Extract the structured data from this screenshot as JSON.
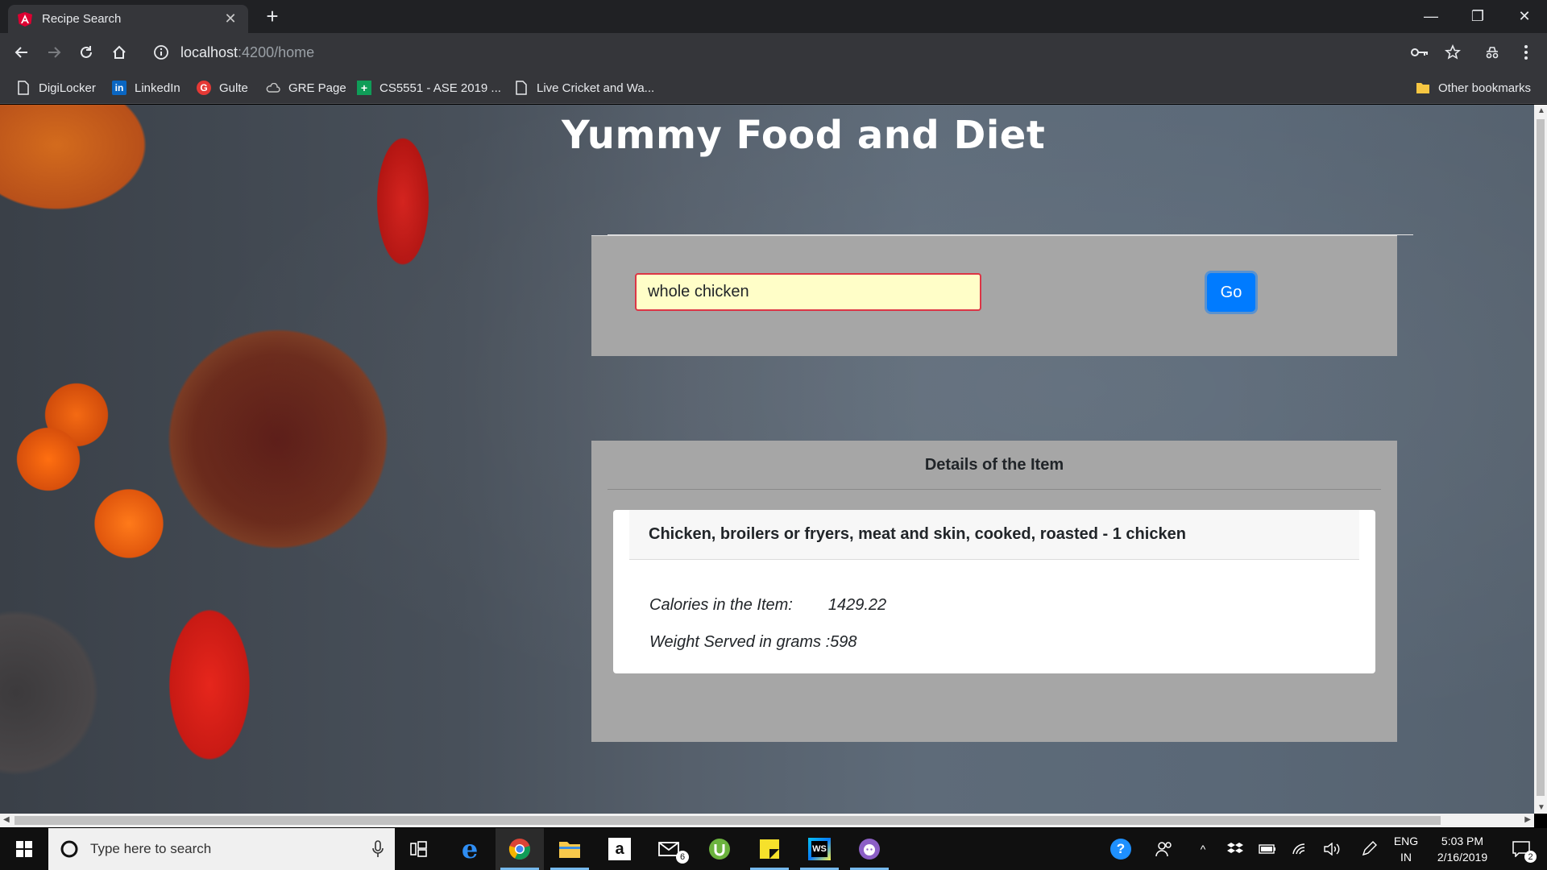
{
  "browser": {
    "tab_title": "Recipe Search",
    "url_host": "localhost",
    "url_path": ":4200/home",
    "bookmarks": [
      "DigiLocker",
      "LinkedIn",
      "Gulte",
      "GRE Page",
      "CS5551 - ASE 2019 ...",
      "Live Cricket and Wa..."
    ],
    "other_bookmarks": "Other bookmarks"
  },
  "page": {
    "title": "Yummy Food and Diet",
    "search": {
      "value": "whole chicken",
      "go_label": "Go"
    },
    "details": {
      "header": "Details of the Item",
      "item_name": "Chicken, broilers or fryers, meat and skin, cooked, roasted - 1 chicken",
      "calories_label": "Calories in the Item:",
      "calories_value": "1429.22",
      "weight_label": "Weight Served in grams :",
      "weight_value": "598"
    }
  },
  "taskbar": {
    "search_placeholder": "Type here to search",
    "mail_badge": "6",
    "lang_top": "ENG",
    "lang_bottom": "IN",
    "time": "5:03 PM",
    "date": "2/16/2019",
    "notification_count": "2"
  },
  "colors": {
    "go_button": "#007bff",
    "input_border": "#dc3545",
    "input_bg": "#fffec8",
    "panel_bg": "#a6a6a6"
  }
}
